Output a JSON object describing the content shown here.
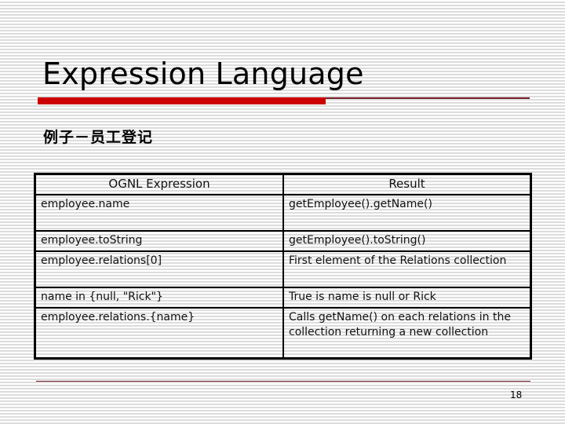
{
  "slide": {
    "title": "Expression Language",
    "subtitle": "例子－员工登记",
    "page_number": "18",
    "accent_color": "#cc0000"
  },
  "table": {
    "headers": [
      "OGNL Expression",
      "Result"
    ],
    "rows": [
      {
        "expression": "employee.name",
        "result": "getEmployee().getName()"
      },
      {
        "expression": "employee.toString",
        "result": "getEmployee().toString()"
      },
      {
        "expression": "employee.relations[0]",
        "result": "First element of the Relations collection"
      },
      {
        "expression": "name in {null, \"Rick\"}",
        "result": "True is name is null or Rick"
      },
      {
        "expression": "employee.relations.{name}",
        "result": "Calls getName() on each relations in the collection returning a new collection"
      }
    ]
  }
}
